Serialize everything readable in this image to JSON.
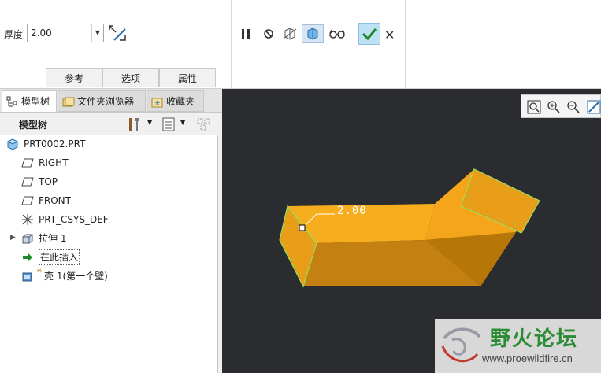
{
  "dashboard": {
    "thickness_label": "厚度",
    "thickness_value": "2.00",
    "tabs": [
      "参考",
      "选项",
      "属性"
    ],
    "tools": [
      "pause-icon",
      "stop-icon",
      "preview-off-icon",
      "verify-preview-icon",
      "glasses-icon"
    ],
    "ok": "ok-check-icon",
    "cancel": "✕"
  },
  "panel": {
    "tabs": [
      {
        "label": "模型树",
        "icon": "model-tree-icon"
      },
      {
        "label": "文件夹浏览器",
        "icon": "folder-icon"
      },
      {
        "label": "收藏夹",
        "icon": "favorites-icon"
      }
    ],
    "tree_title": "模型树",
    "items": [
      {
        "label": "PRT0002.PRT",
        "icon": "part-icon"
      },
      {
        "label": "RIGHT",
        "icon": "datum-plane-icon"
      },
      {
        "label": "TOP",
        "icon": "datum-plane-icon"
      },
      {
        "label": "FRONT",
        "icon": "datum-plane-icon"
      },
      {
        "label": "PRT_CSYS_DEF",
        "icon": "csys-icon"
      },
      {
        "label": "拉伸 1",
        "icon": "extrude-icon"
      },
      {
        "label": "在此插入",
        "icon": "insert-here-arrow-icon"
      },
      {
        "label": "壳 1(第一个壁)",
        "icon": "shell-icon"
      }
    ]
  },
  "graphics": {
    "dimension_text": "2.00",
    "colors": {
      "background": "#2b2c30",
      "part": "#f4a61c",
      "edge_highlight": "#9be05a"
    }
  },
  "watermark": {
    "title": "野火论坛",
    "url": "www.proewildfire.cn"
  }
}
